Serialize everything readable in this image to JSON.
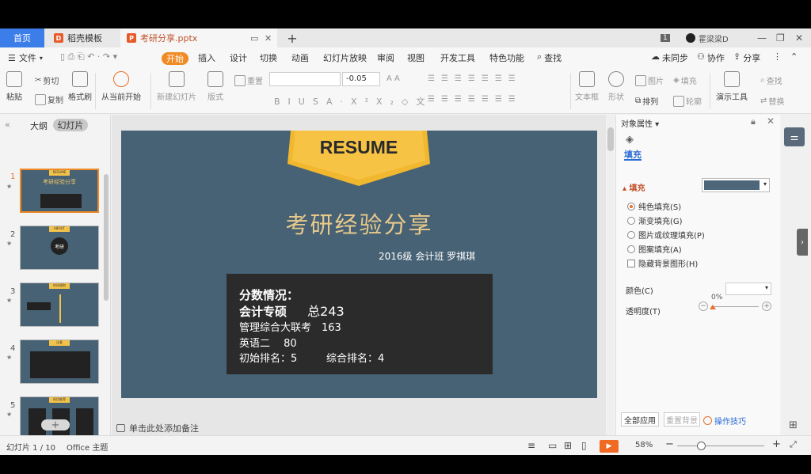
{
  "tabs": {
    "home": "首页",
    "daoke": "稻壳模板",
    "doc": "考研分享.pptx",
    "add": "+",
    "user_badge": "1",
    "user_name": "霍梁梁D"
  },
  "menu": {
    "file": "文件",
    "items": [
      "开始",
      "插入",
      "设计",
      "切换",
      "动画",
      "幻灯片放映",
      "审阅",
      "视图",
      "开发工具",
      "特色功能",
      "查找"
    ],
    "unsync": "未同步",
    "collab": "协作",
    "share": "分享"
  },
  "toolbar": {
    "paste": "粘贴",
    "cut": "剪切",
    "copy": "复制",
    "format_brush": "格式刷",
    "from_current": "从当前开始",
    "new_slide": "新建幻灯片",
    "layout": "版式",
    "reset": "重置",
    "font_size": "-0.05",
    "textbox": "文本框",
    "shape": "形状",
    "arrange": "排列",
    "picture": "图片",
    "fill": "填充",
    "outline": "轮廓",
    "presentation_tools": "演示工具",
    "find": "查找",
    "replace": "替换"
  },
  "leftpanel": {
    "outline_tab": "大纲",
    "slides_tab": "幻灯片",
    "thumbs": [
      {
        "num": "1",
        "badge": "RESUME",
        "title": "考研经验分享"
      },
      {
        "num": "2",
        "badge": "ABOUT",
        "title": "考研"
      },
      {
        "num": "3",
        "badge": "时间规划",
        "title": ""
      },
      {
        "num": "4",
        "badge": "注意",
        "title": ""
      },
      {
        "num": "5",
        "badge": "科目推荐",
        "title": ""
      }
    ]
  },
  "slide": {
    "badge": "RESUME",
    "title": "考研经验分享",
    "subtitle": "2016级 会计班 罗祺琪",
    "score": {
      "line1": "分数情况：",
      "line2_label": "会计专硕",
      "line2_total": "总243",
      "line3": "管理综合大联考　163",
      "line4": "英语二　 80",
      "line5_a": "初始排名：5",
      "line5_b": "综合排名：4"
    }
  },
  "notes_placeholder": "单击此处添加备注",
  "rightpanel": {
    "title": "对象属性",
    "fill_tab": "填充",
    "fill_head": "填充",
    "options": [
      "纯色填充(S)",
      "渐变填充(G)",
      "图片或纹理填充(P)",
      "图案填充(A)"
    ],
    "hide_bg": "隐藏背景图形(H)",
    "color_label": "颜色(C)",
    "transparency_label": "透明度(T)",
    "transparency_value": "0%",
    "apply_all": "全部应用",
    "reset_bg": "重置背景",
    "tips": "操作技巧",
    "fill_color": "#4e6679"
  },
  "status": {
    "slide_pos": "幻灯片 1 / 10",
    "theme": "Office 主题",
    "zoom": "58%"
  }
}
